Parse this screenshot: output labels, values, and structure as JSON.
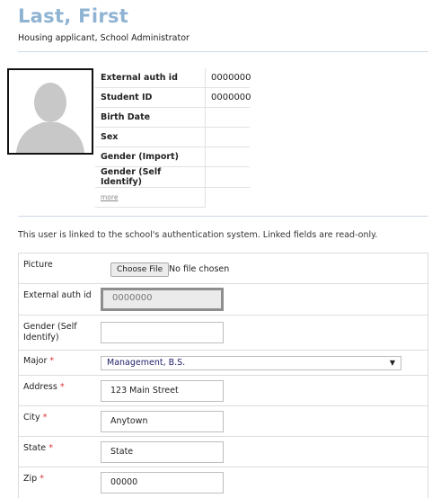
{
  "header": {
    "name": "Last, First",
    "roles": "Housing applicant, School Administrator"
  },
  "profile": {
    "fields": [
      {
        "label": "External auth id",
        "value": "0000000"
      },
      {
        "label": "Student ID",
        "value": "0000000"
      },
      {
        "label": "Birth Date",
        "value": ""
      },
      {
        "label": "Sex",
        "value": ""
      },
      {
        "label": "Gender (Import)",
        "value": ""
      },
      {
        "label": "Gender (Self Identify)",
        "value": ""
      }
    ],
    "more_link": "more"
  },
  "notice": "This user is linked to the school's authentication system. Linked fields are read-only.",
  "form": {
    "picture": {
      "label": "Picture",
      "button": "Choose File",
      "status": "No file chosen"
    },
    "external_auth": {
      "label": "External auth id",
      "value": "0000000"
    },
    "gender_self": {
      "label": "Gender (Self Identify)",
      "value": ""
    },
    "major": {
      "label": "Major",
      "required": "*",
      "value": "Management, B.S."
    },
    "address": {
      "label": "Address",
      "required": "*",
      "value": "123 Main Street"
    },
    "city": {
      "label": "City",
      "required": "*",
      "value": "Anytown"
    },
    "state": {
      "label": "State",
      "required": "*",
      "value": "State"
    },
    "zip": {
      "label": "Zip",
      "required": "*",
      "value": "00000"
    }
  }
}
